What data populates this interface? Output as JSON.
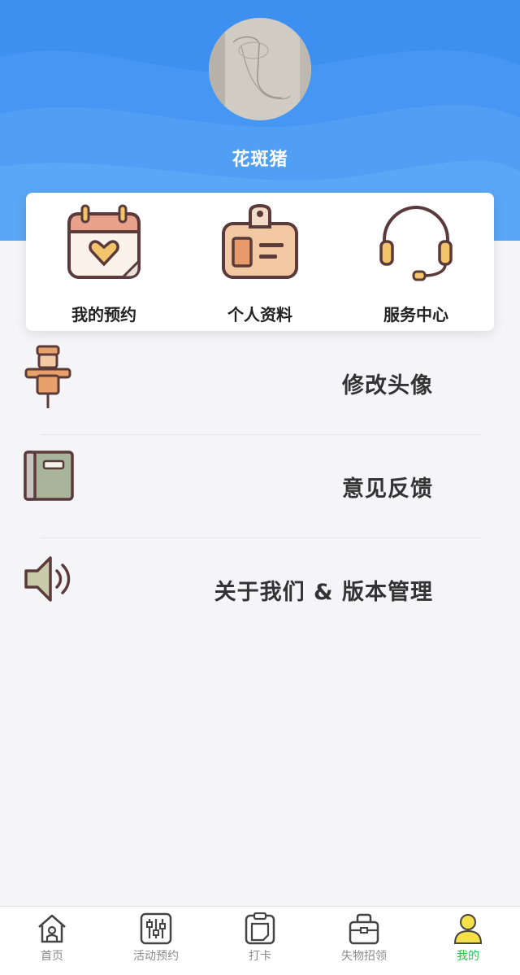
{
  "profile": {
    "username": "花斑猪"
  },
  "quick_actions": [
    {
      "label": "我的预约",
      "icon": "calendar-heart-icon"
    },
    {
      "label": "个人资料",
      "icon": "id-badge-icon"
    },
    {
      "label": "服务中心",
      "icon": "headset-icon"
    }
  ],
  "menu": [
    {
      "label": "修改头像",
      "icon": "scarecrow-icon"
    },
    {
      "label": "意见反馈",
      "icon": "notebook-icon"
    },
    {
      "label": "关于我们 & 版本管理",
      "icon": "speaker-icon"
    }
  ],
  "tabbar": [
    {
      "label": "首页",
      "icon": "home-icon"
    },
    {
      "label": "活动预约",
      "icon": "sliders-icon"
    },
    {
      "label": "打卡",
      "icon": "clipboard-icon"
    },
    {
      "label": "失物招领",
      "icon": "bag-icon"
    },
    {
      "label": "我的",
      "icon": "user-icon",
      "active": true
    }
  ],
  "colors": {
    "header_blue": "#3d8ff0",
    "active_tab": "#2bbf4b",
    "icon_outline": "#5a3a3a"
  }
}
